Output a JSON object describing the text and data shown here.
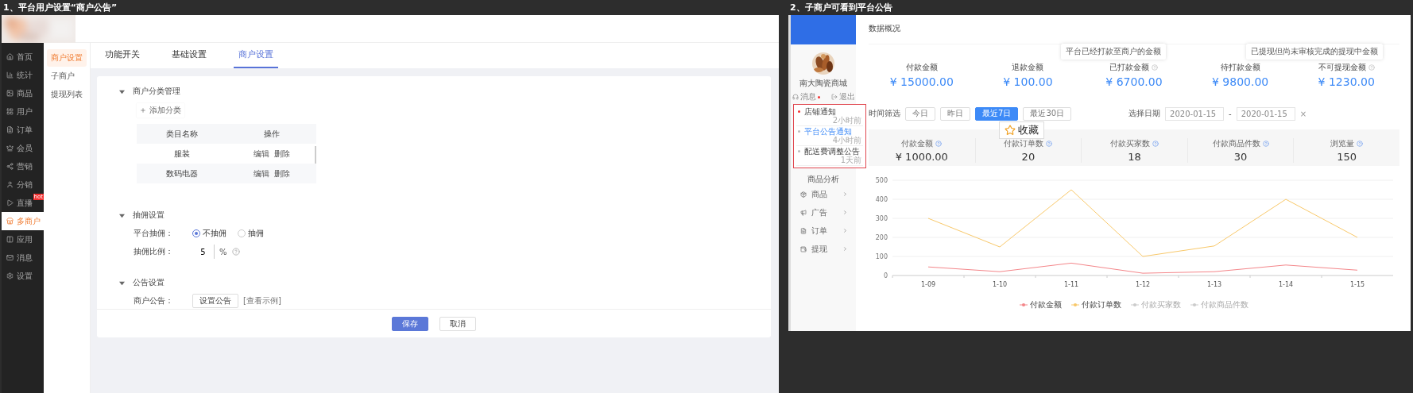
{
  "left_panel": {
    "caption": "1、平台用户设置“商户公告”",
    "sidebar": {
      "items": [
        {
          "label": "首页",
          "selected": false
        },
        {
          "label": "统计",
          "selected": false
        },
        {
          "label": "商品",
          "selected": false
        },
        {
          "label": "用户",
          "selected": false
        },
        {
          "label": "订单",
          "selected": false
        },
        {
          "label": "会员",
          "selected": false
        },
        {
          "label": "营销",
          "selected": false
        },
        {
          "label": "分销",
          "selected": false
        },
        {
          "label": "直播",
          "selected": false,
          "badge": "hot"
        },
        {
          "label": "多商户",
          "selected": true
        },
        {
          "label": "应用",
          "selected": false
        },
        {
          "label": "消息",
          "selected": false
        },
        {
          "label": "设置",
          "selected": false
        }
      ]
    },
    "submenu": {
      "items": [
        {
          "label": "商户设置",
          "selected": true
        },
        {
          "label": "子商户",
          "selected": false
        },
        {
          "label": "提现列表",
          "selected": false
        }
      ]
    },
    "tabs": [
      {
        "label": "功能开关",
        "selected": false
      },
      {
        "label": "基础设置",
        "selected": false
      },
      {
        "label": "商户设置",
        "selected": true
      }
    ],
    "category_section": {
      "title": "商户分类管理",
      "expanded": true,
      "add_button": "添加分类",
      "columns": [
        "类目名称",
        "操作"
      ],
      "rows": [
        {
          "name": "服装",
          "actions": [
            "编辑",
            "删除"
          ]
        },
        {
          "name": "数码电器",
          "actions": [
            "编辑",
            "删除"
          ]
        }
      ]
    },
    "commission_section": {
      "title": "抽佣设置",
      "expanded": true,
      "mode_label": "平台抽佣：",
      "options": [
        {
          "label": "不抽佣",
          "selected": true
        },
        {
          "label": "抽佣",
          "selected": false
        }
      ],
      "rate_label": "抽佣比例：",
      "rate_value": "5",
      "rate_unit": "%"
    },
    "notice_section": {
      "title": "公告设置",
      "expanded": true,
      "label": "商户公告：",
      "button": "设置公告",
      "link": "[查看示例]"
    },
    "footer": {
      "save": "保存",
      "cancel": "取消"
    }
  },
  "right_panel": {
    "caption": "2、子商户可看到平台公告",
    "profile": {
      "name": "南大陶瓷商城",
      "messages": "消息",
      "message_unread": true,
      "logout": "退出"
    },
    "notifications": [
      {
        "title": "店铺通知",
        "time": "2小时前",
        "unread": true,
        "selected": false
      },
      {
        "title": "平台公告通知",
        "time": "4小时前",
        "unread": false,
        "selected": true
      },
      {
        "title": "配送费调整公告",
        "time": "1天前",
        "unread": false,
        "selected": false
      }
    ],
    "nav": {
      "heading": "商品分析",
      "items": [
        {
          "label": "商品"
        },
        {
          "label": "广告"
        },
        {
          "label": "订单"
        },
        {
          "label": "提现"
        }
      ]
    },
    "page_title": "数据概况",
    "stats": [
      {
        "label": "付款金额",
        "value": "¥ 15000.00"
      },
      {
        "label": "退款金额",
        "value": "¥ 100.00"
      },
      {
        "label": "已打款金额",
        "value": "¥ 6700.00",
        "tooltip": "平台已经打款至商户的金额"
      },
      {
        "label": "待打款金额",
        "value": "¥ 9800.00"
      },
      {
        "label": "不可提现金额",
        "value": "¥ 1230.00",
        "tooltip": "已提现但尚未审核完成的提现中金额"
      }
    ],
    "filter": {
      "label": "时间筛选",
      "ranges": [
        {
          "label": "今日",
          "selected": false
        },
        {
          "label": "昨日",
          "selected": false
        },
        {
          "label": "最近7日",
          "selected": true
        },
        {
          "label": "最近30日",
          "selected": false
        }
      ],
      "date_label": "选择日期",
      "start": "2020-01-15",
      "separator": "-",
      "end": "2020-01-15",
      "clear": "×"
    },
    "bookmark_popup": {
      "label": "收藏"
    },
    "metrics": [
      {
        "label": "付款金额",
        "value": "¥ 1000.00"
      },
      {
        "label": "付款订单数",
        "value": "20"
      },
      {
        "label": "付款买家数",
        "value": "18"
      },
      {
        "label": "付款商品件数",
        "value": "30"
      },
      {
        "label": "浏览量",
        "value": "150"
      }
    ],
    "chart": {
      "chart_data": {
        "type": "line",
        "grid": true,
        "categories": [
          "1-09",
          "1-10",
          "1-11",
          "1-12",
          "1-13",
          "1-14",
          "1-15"
        ],
        "ylim": [
          0,
          500
        ],
        "yticks": [
          0,
          100,
          200,
          300,
          400,
          500
        ],
        "series": [
          {
            "name": "付款金额",
            "color": "#f4868a",
            "values": [
              45,
              20,
              65,
              12,
              20,
              55,
              28
            ]
          },
          {
            "name": "付款订单数",
            "color": "#f8c86a",
            "values": [
              300,
              150,
              450,
              100,
              155,
              400,
              200
            ]
          }
        ]
      },
      "hidden_series": [
        {
          "label": "付款买家数",
          "enabled": false
        },
        {
          "label": "付款商品件数",
          "enabled": false
        }
      ]
    }
  }
}
